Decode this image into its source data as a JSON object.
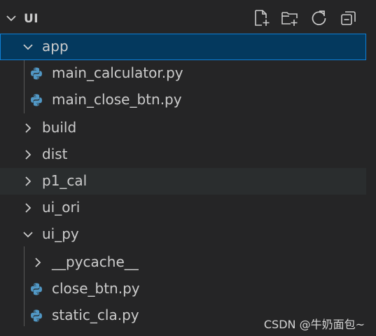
{
  "explorer": {
    "title": "UI",
    "actions": {
      "new_file_icon": "new-file-icon",
      "new_folder_icon": "new-folder-icon",
      "refresh_icon": "refresh-icon",
      "collapse_icon": "collapse-all-icon"
    }
  },
  "tree": {
    "app": "app",
    "main_calculator": "main_calculator.py",
    "main_close_btn": "main_close_btn.py",
    "build": "build",
    "dist": "dist",
    "p1_cal": "p1_cal",
    "ui_ori": "ui_ori",
    "ui_py": "ui_py",
    "pycache": "__pycache__",
    "close_btn": "close_btn.py",
    "static_cla": "static_cla.py"
  },
  "colors": {
    "background": "#252526",
    "selected_bg": "#04395e",
    "selected_border": "#0f7fd6",
    "python_blue": "#5197c4"
  },
  "watermark": "CSDN @牛奶面包~"
}
